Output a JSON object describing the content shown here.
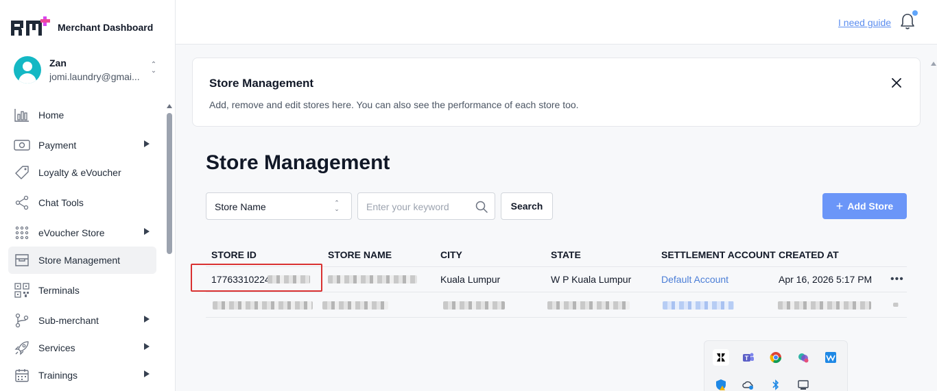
{
  "brand": {
    "title": "Merchant Dashboard"
  },
  "user": {
    "name": "Zan",
    "email": "jomi.laundry@gmai..."
  },
  "nav": [
    {
      "label": "Home",
      "icon": "bar-chart-icon",
      "arrow": false,
      "active": false
    },
    {
      "label": "Payment",
      "icon": "cash-icon",
      "arrow": true,
      "active": false
    },
    {
      "label": "Loyalty & eVoucher",
      "icon": "tag-icon",
      "arrow": false,
      "active": false
    },
    {
      "label": "Chat Tools",
      "icon": "share-icon",
      "arrow": false,
      "active": false
    },
    {
      "label": "eVoucher Store",
      "icon": "grid-dots-icon",
      "arrow": true,
      "active": false
    },
    {
      "label": "Store Management",
      "icon": "store-icon",
      "arrow": false,
      "active": true
    },
    {
      "label": "Terminals",
      "icon": "qr-code-icon",
      "arrow": false,
      "active": false
    },
    {
      "label": "Sub-merchant",
      "icon": "branch-icon",
      "arrow": true,
      "active": false
    },
    {
      "label": "Services",
      "icon": "rocket-icon",
      "arrow": true,
      "active": false
    },
    {
      "label": "Trainings",
      "icon": "calendar-icon",
      "arrow": true,
      "active": false
    }
  ],
  "topbar": {
    "guide_link": "I need guide"
  },
  "banner": {
    "title": "Store Management",
    "description": "Add, remove and edit stores here. You can also see the performance of each store too."
  },
  "page": {
    "title": "Store Management"
  },
  "filters": {
    "select_value": "Store Name",
    "search_placeholder": "Enter your keyword",
    "search_label": "Search",
    "add_label": "Add Store"
  },
  "table": {
    "headers": [
      "STORE ID",
      "STORE NAME",
      "CITY",
      "STATE",
      "SETTLEMENT ACCOUNT",
      "CREATED AT"
    ],
    "rows": [
      {
        "store_id": "17763310224",
        "city": "Kuala Lumpur",
        "state": "W P Kuala Lumpur",
        "settlement_account": "Default Account",
        "created_at": "Apr 16, 2026 5:17 PM"
      }
    ]
  },
  "colors": {
    "accent": "#6b96f8",
    "link": "#4a7dd6",
    "highlight": "#d93030"
  }
}
